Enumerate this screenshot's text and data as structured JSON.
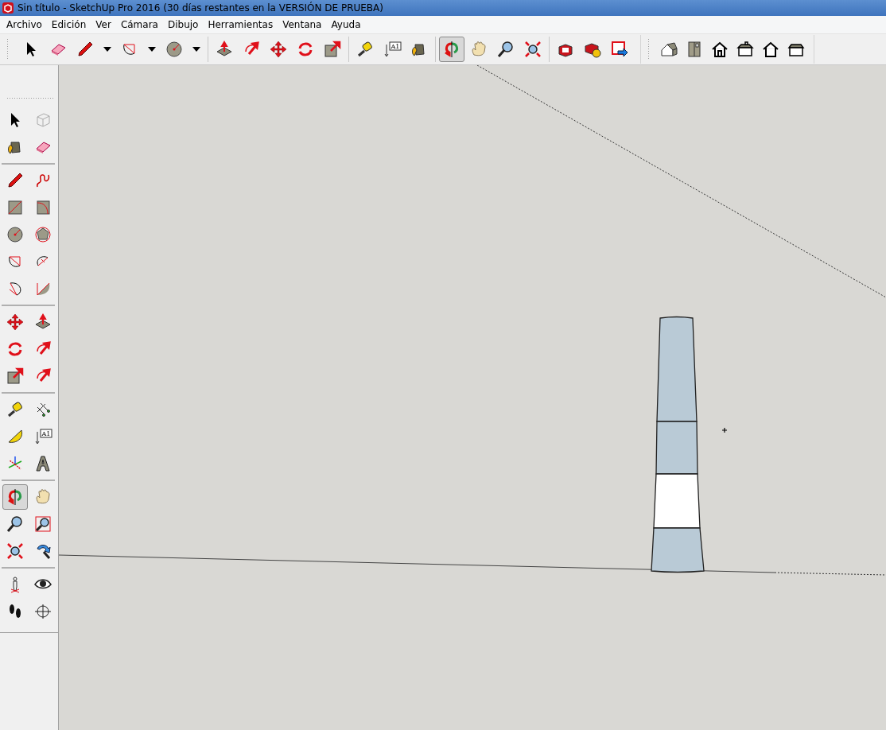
{
  "window": {
    "title": "Sin título - SketchUp Pro 2016 (30 días restantes en la VERSIÓN DE PRUEBA)"
  },
  "menu": [
    "Archivo",
    "Edición",
    "Ver",
    "Cámara",
    "Dibujo",
    "Herramientas",
    "Ventana",
    "Ayuda"
  ],
  "top_toolbar": [
    [
      {
        "kind": "select",
        "selected": false
      },
      {
        "kind": "eraser",
        "selected": false
      },
      {
        "kind": "pencil",
        "selected": false,
        "dropdown": true
      },
      {
        "kind": "arc",
        "selected": false,
        "dropdown": true
      },
      {
        "kind": "circle",
        "selected": false,
        "dropdown": true
      }
    ],
    [
      {
        "kind": "pushpull",
        "selected": false
      },
      {
        "kind": "offset",
        "selected": false
      },
      {
        "kind": "move",
        "selected": false
      },
      {
        "kind": "rotate",
        "selected": false
      },
      {
        "kind": "scale",
        "selected": false
      }
    ],
    [
      {
        "kind": "tape",
        "selected": false
      },
      {
        "kind": "text",
        "selected": false,
        "label": "A1"
      },
      {
        "kind": "paint",
        "selected": false
      }
    ],
    [
      {
        "kind": "orbit",
        "selected": true
      },
      {
        "kind": "pan",
        "selected": false
      },
      {
        "kind": "zoom",
        "selected": false
      },
      {
        "kind": "zoomextents",
        "selected": false
      }
    ],
    [
      {
        "kind": "warehouse",
        "selected": false
      },
      {
        "kind": "extensions",
        "selected": false
      },
      {
        "kind": "sendlayout",
        "selected": false
      }
    ]
  ],
  "views_toolbar": [
    {
      "kind": "iso"
    },
    {
      "kind": "top"
    },
    {
      "kind": "front"
    },
    {
      "kind": "right"
    },
    {
      "kind": "back"
    },
    {
      "kind": "left"
    }
  ],
  "left_toolbar": [
    [
      {
        "kind": "select",
        "selected": false
      },
      {
        "kind": "component",
        "selected": false
      },
      {
        "kind": "paint",
        "selected": false
      },
      {
        "kind": "eraser",
        "selected": false
      }
    ],
    [
      {
        "kind": "pencil",
        "selected": false
      },
      {
        "kind": "freehand",
        "selected": false
      },
      {
        "kind": "rectangle",
        "selected": false
      },
      {
        "kind": "rotrect",
        "selected": false
      },
      {
        "kind": "circle",
        "selected": false
      },
      {
        "kind": "polygon",
        "selected": false
      },
      {
        "kind": "arc",
        "selected": false
      },
      {
        "kind": "arc2",
        "selected": false
      },
      {
        "kind": "arc3",
        "selected": false
      },
      {
        "kind": "pie",
        "selected": false
      }
    ],
    [
      {
        "kind": "move",
        "selected": false
      },
      {
        "kind": "pushpull",
        "selected": false
      },
      {
        "kind": "rotate",
        "selected": false
      },
      {
        "kind": "followme",
        "selected": false
      },
      {
        "kind": "scale",
        "selected": false
      },
      {
        "kind": "offset",
        "selected": false
      }
    ],
    [
      {
        "kind": "tape",
        "selected": false
      },
      {
        "kind": "dimension",
        "selected": false
      },
      {
        "kind": "protractor",
        "selected": false
      },
      {
        "kind": "text",
        "selected": false,
        "label": "A1"
      },
      {
        "kind": "axes",
        "selected": false
      },
      {
        "kind": "text3d",
        "selected": false
      }
    ],
    [
      {
        "kind": "orbit",
        "selected": true
      },
      {
        "kind": "pan",
        "selected": false
      },
      {
        "kind": "zoom",
        "selected": false
      },
      {
        "kind": "zoomwindow",
        "selected": false
      },
      {
        "kind": "zoomextents",
        "selected": false
      },
      {
        "kind": "previous",
        "selected": false
      }
    ],
    [
      {
        "kind": "walk",
        "selected": false
      },
      {
        "kind": "lookaround",
        "selected": false
      },
      {
        "kind": "footprints",
        "selected": false
      },
      {
        "kind": "position",
        "selected": false
      }
    ]
  ]
}
